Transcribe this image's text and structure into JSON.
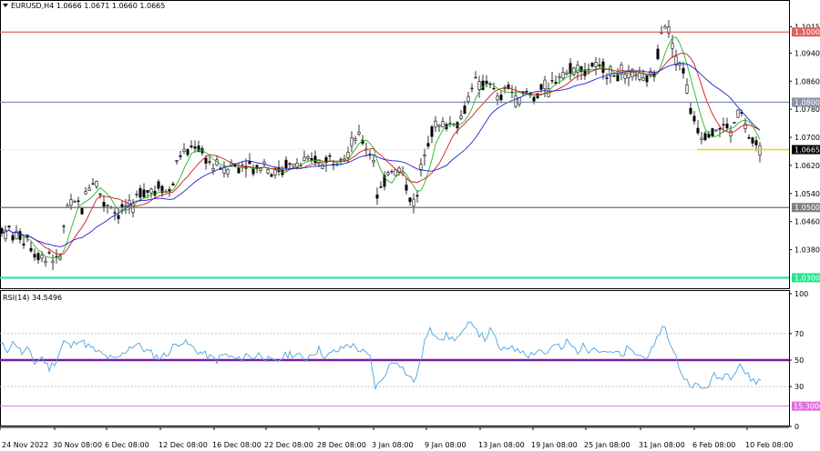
{
  "header": {
    "symbol": "EURUSD,H4",
    "ohlc": "1.0666 1.0671 1.0660 1.0665"
  },
  "indicator": {
    "label": "RSI(14) 34.5496"
  },
  "colors": {
    "background": "#ffffff",
    "grid": "#c8c8c8",
    "candle": "#000000",
    "ma_fast": "#22b822",
    "ma_mid": "#d01818",
    "ma_slow": "#2020d0",
    "rsi_line": "#4da3e0",
    "rsi_mid": "#7a1aa0",
    "rsi_low": "#e070e0"
  },
  "chart_data": [
    {
      "type": "candlestick",
      "title": "EURUSD,H4",
      "ylim": [
        1.027,
        1.1055
      ],
      "y_ticks": [
        1.1015,
        1.094,
        1.086,
        1.078,
        1.07,
        1.062,
        1.054,
        1.046,
        1.038
      ],
      "x_ticks": [
        "24 Nov 2022",
        "30 Nov 08:00",
        "6 Dec 08:00",
        "12 Dec 08:00",
        "16 Dec 08:00",
        "22 Dec 08:00",
        "28 Dec 08:00",
        "3 Jan 08:00",
        "9 Jan 08:00",
        "13 Jan 08:00",
        "19 Jan 08:00",
        "25 Jan 08:00",
        "31 Jan 08:00",
        "6 Feb 08:00",
        "10 Feb 08:00"
      ],
      "path_points": [
        [
          0,
          1.045
        ],
        [
          5,
          1.042
        ],
        [
          10,
          1.044
        ],
        [
          15,
          1.041
        ],
        [
          20,
          1.043
        ],
        [
          25,
          1.04
        ],
        [
          30,
          1.042
        ],
        [
          35,
          1.038
        ],
        [
          40,
          1.036
        ],
        [
          45,
          1.037
        ],
        [
          50,
          1.035
        ],
        [
          55,
          1.038
        ],
        [
          60,
          1.034
        ],
        [
          65,
          1.035
        ],
        [
          70,
          1.044
        ],
        [
          75,
          1.052
        ],
        [
          80,
          1.05
        ],
        [
          85,
          1.052
        ],
        [
          90,
          1.049
        ],
        [
          95,
          1.055
        ],
        [
          100,
          1.057
        ],
        [
          105,
          1.058
        ],
        [
          110,
          1.054
        ],
        [
          115,
          1.05
        ],
        [
          120,
          1.052
        ],
        [
          125,
          1.049
        ],
        [
          130,
          1.048
        ],
        [
          135,
          1.05
        ],
        [
          140,
          1.051
        ],
        [
          145,
          1.049
        ],
        [
          150,
          1.053
        ],
        [
          155,
          1.055
        ],
        [
          160,
          1.054
        ],
        [
          165,
          1.056
        ],
        [
          170,
          1.054
        ],
        [
          175,
          1.057
        ],
        [
          180,
          1.055
        ],
        [
          185,
          1.054
        ],
        [
          190,
          1.057
        ],
        [
          195,
          1.064
        ],
        [
          200,
          1.066
        ],
        [
          205,
          1.065
        ],
        [
          210,
          1.067
        ],
        [
          215,
          1.068
        ],
        [
          220,
          1.066
        ],
        [
          225,
          1.064
        ],
        [
          230,
          1.063
        ],
        [
          235,
          1.061
        ],
        [
          240,
          1.063
        ],
        [
          245,
          1.06
        ],
        [
          250,
          1.061
        ],
        [
          255,
          1.063
        ],
        [
          260,
          1.061
        ],
        [
          265,
          1.062
        ],
        [
          270,
          1.063
        ],
        [
          275,
          1.062
        ],
        [
          280,
          1.06
        ],
        [
          285,
          1.062
        ],
        [
          290,
          1.063
        ],
        [
          295,
          1.061
        ],
        [
          300,
          1.059
        ],
        [
          305,
          1.061
        ],
        [
          310,
          1.06
        ],
        [
          315,
          1.063
        ],
        [
          320,
          1.061
        ],
        [
          325,
          1.063
        ],
        [
          330,
          1.062
        ],
        [
          335,
          1.064
        ],
        [
          340,
          1.062
        ],
        [
          345,
          1.064
        ],
        [
          350,
          1.063
        ],
        [
          355,
          1.062
        ],
        [
          360,
          1.065
        ],
        [
          365,
          1.063
        ],
        [
          370,
          1.064
        ],
        [
          375,
          1.066
        ],
        [
          380,
          1.064
        ],
        [
          385,
          1.068
        ],
        [
          390,
          1.07
        ],
        [
          395,
          1.07
        ],
        [
          400,
          1.068
        ],
        [
          405,
          1.066
        ],
        [
          410,
          1.064
        ],
        [
          413,
          1.053
        ],
        [
          418,
          1.055
        ],
        [
          423,
          1.058
        ],
        [
          428,
          1.062
        ],
        [
          433,
          1.06
        ],
        [
          438,
          1.061
        ],
        [
          443,
          1.059
        ],
        [
          448,
          1.054
        ],
        [
          453,
          1.051
        ],
        [
          458,
          1.053
        ],
        [
          462,
          1.061
        ],
        [
          467,
          1.068
        ],
        [
          472,
          1.07
        ],
        [
          477,
          1.074
        ],
        [
          482,
          1.073
        ],
        [
          487,
          1.074
        ],
        [
          492,
          1.073
        ],
        [
          497,
          1.075
        ],
        [
          502,
          1.074
        ],
        [
          507,
          1.076
        ],
        [
          512,
          1.079
        ],
        [
          517,
          1.085
        ],
        [
          522,
          1.086
        ],
        [
          527,
          1.084
        ],
        [
          532,
          1.085
        ],
        [
          537,
          1.087
        ],
        [
          542,
          1.083
        ],
        [
          547,
          1.08
        ],
        [
          552,
          1.082
        ],
        [
          557,
          1.085
        ],
        [
          562,
          1.083
        ],
        [
          567,
          1.08
        ],
        [
          572,
          1.081
        ],
        [
          577,
          1.083
        ],
        [
          582,
          1.082
        ],
        [
          587,
          1.081
        ],
        [
          592,
          1.083
        ],
        [
          597,
          1.085
        ],
        [
          602,
          1.083
        ],
        [
          607,
          1.086
        ],
        [
          612,
          1.087
        ],
        [
          617,
          1.089
        ],
        [
          622,
          1.088
        ],
        [
          627,
          1.09
        ],
        [
          632,
          1.089
        ],
        [
          637,
          1.091
        ],
        [
          642,
          1.088
        ],
        [
          647,
          1.09
        ],
        [
          652,
          1.091
        ],
        [
          657,
          1.089
        ],
        [
          662,
          1.09
        ],
        [
          667,
          1.088
        ],
        [
          672,
          1.089
        ],
        [
          677,
          1.087
        ],
        [
          682,
          1.089
        ],
        [
          687,
          1.086
        ],
        [
          692,
          1.088
        ],
        [
          697,
          1.089
        ],
        [
          702,
          1.087
        ],
        [
          707,
          1.085
        ],
        [
          712,
          1.088
        ],
        [
          717,
          1.087
        ],
        [
          722,
          1.094
        ],
        [
          727,
          1.103
        ],
        [
          732,
          1.102
        ],
        [
          737,
          1.098
        ],
        [
          742,
          1.092
        ],
        [
          747,
          1.091
        ],
        [
          752,
          1.088
        ],
        [
          757,
          1.078
        ],
        [
          762,
          1.075
        ],
        [
          767,
          1.072
        ],
        [
          772,
          1.07
        ],
        [
          777,
          1.072
        ],
        [
          782,
          1.071
        ],
        [
          787,
          1.073
        ],
        [
          792,
          1.072
        ],
        [
          797,
          1.074
        ],
        [
          802,
          1.071
        ],
        [
          807,
          1.075
        ],
        [
          812,
          1.078
        ],
        [
          817,
          1.074
        ],
        [
          822,
          1.07
        ],
        [
          827,
          1.068
        ],
        [
          832,
          1.067
        ],
        [
          835,
          1.0665
        ]
      ]
    },
    {
      "type": "line",
      "title": "RSI(14) 34.5496",
      "ylim": [
        0,
        100
      ],
      "y_ticks": [
        100,
        70,
        50,
        30,
        0
      ],
      "levels": [
        {
          "value": 70
        },
        {
          "value": 30
        },
        {
          "value": 50
        },
        {
          "value": 15.3
        }
      ],
      "series": [
        {
          "name": "RSI(14)",
          "points": [
            [
              0,
              62
            ],
            [
              8,
              58
            ],
            [
              16,
              64
            ],
            [
              24,
              55
            ],
            [
              30,
              58
            ],
            [
              38,
              48
            ],
            [
              46,
              52
            ],
            [
              54,
              44
            ],
            [
              62,
              50
            ],
            [
              70,
              64
            ],
            [
              78,
              60
            ],
            [
              86,
              66
            ],
            [
              94,
              62
            ],
            [
              102,
              58
            ],
            [
              110,
              55
            ],
            [
              118,
              52
            ],
            [
              126,
              50
            ],
            [
              134,
              54
            ],
            [
              142,
              60
            ],
            [
              150,
              62
            ],
            [
              158,
              58
            ],
            [
              166,
              55
            ],
            [
              174,
              52
            ],
            [
              182,
              54
            ],
            [
              190,
              60
            ],
            [
              198,
              64
            ],
            [
              206,
              62
            ],
            [
              214,
              58
            ],
            [
              222,
              55
            ],
            [
              230,
              52
            ],
            [
              238,
              50
            ],
            [
              246,
              54
            ],
            [
              254,
              52
            ],
            [
              262,
              50
            ],
            [
              270,
              54
            ],
            [
              278,
              52
            ],
            [
              286,
              55
            ],
            [
              294,
              50
            ],
            [
              302,
              48
            ],
            [
              310,
              52
            ],
            [
              318,
              55
            ],
            [
              326,
              54
            ],
            [
              334,
              50
            ],
            [
              342,
              55
            ],
            [
              350,
              58
            ],
            [
              358,
              52
            ],
            [
              366,
              56
            ],
            [
              374,
              58
            ],
            [
              382,
              62
            ],
            [
              390,
              60
            ],
            [
              398,
              56
            ],
            [
              406,
              52
            ],
            [
              412,
              30
            ],
            [
              418,
              33
            ],
            [
              424,
              42
            ],
            [
              430,
              48
            ],
            [
              436,
              50
            ],
            [
              442,
              44
            ],
            [
              448,
              38
            ],
            [
              454,
              34
            ],
            [
              460,
              44
            ],
            [
              466,
              64
            ],
            [
              472,
              72
            ],
            [
              478,
              70
            ],
            [
              484,
              67
            ],
            [
              490,
              68
            ],
            [
              496,
              66
            ],
            [
              502,
              67
            ],
            [
              508,
              70
            ],
            [
              514,
              76
            ],
            [
              520,
              78
            ],
            [
              526,
              70
            ],
            [
              532,
              66
            ],
            [
              538,
              72
            ],
            [
              544,
              66
            ],
            [
              550,
              56
            ],
            [
              556,
              58
            ],
            [
              562,
              62
            ],
            [
              568,
              56
            ],
            [
              574,
              58
            ],
            [
              580,
              54
            ],
            [
              586,
              56
            ],
            [
              592,
              58
            ],
            [
              598,
              55
            ],
            [
              604,
              58
            ],
            [
              610,
              62
            ],
            [
              616,
              57
            ],
            [
              622,
              64
            ],
            [
              628,
              60
            ],
            [
              634,
              57
            ],
            [
              640,
              60
            ],
            [
              646,
              58
            ],
            [
              652,
              62
            ],
            [
              658,
              56
            ],
            [
              664,
              58
            ],
            [
              670,
              54
            ],
            [
              676,
              56
            ],
            [
              682,
              52
            ],
            [
              688,
              58
            ],
            [
              694,
              56
            ],
            [
              700,
              54
            ],
            [
              706,
              52
            ],
            [
              712,
              55
            ],
            [
              718,
              58
            ],
            [
              724,
              72
            ],
            [
              730,
              76
            ],
            [
              736,
              60
            ],
            [
              742,
              52
            ],
            [
              748,
              40
            ],
            [
              754,
              34
            ],
            [
              760,
              32
            ],
            [
              766,
              30
            ],
            [
              772,
              28
            ],
            [
              778,
              32
            ],
            [
              784,
              38
            ],
            [
              790,
              36
            ],
            [
              796,
              40
            ],
            [
              802,
              38
            ],
            [
              808,
              44
            ],
            [
              812,
              48
            ],
            [
              818,
              40
            ],
            [
              824,
              36
            ],
            [
              830,
              34
            ],
            [
              835,
              34.5
            ]
          ]
        }
      ]
    }
  ],
  "h_levels": [
    {
      "price": 1.1,
      "label": "1.1000",
      "color": "#e06060",
      "label_bg": "#e06060"
    },
    {
      "price": 1.08,
      "label": "1.0800",
      "color": "#7a8aa8",
      "label_bg": "#8a94a8"
    },
    {
      "price": 1.05,
      "label": "1.0500",
      "color": "#707070",
      "label_bg": "#808080"
    },
    {
      "price": 1.03,
      "label": "1.0300",
      "color": "#20e890",
      "label_bg": "#20e890"
    },
    {
      "price": 1.0665,
      "label": "1.0665",
      "color": "#e8d800",
      "label_bg": "#000000",
      "segment": true
    }
  ],
  "current_price_line": 1.0665
}
